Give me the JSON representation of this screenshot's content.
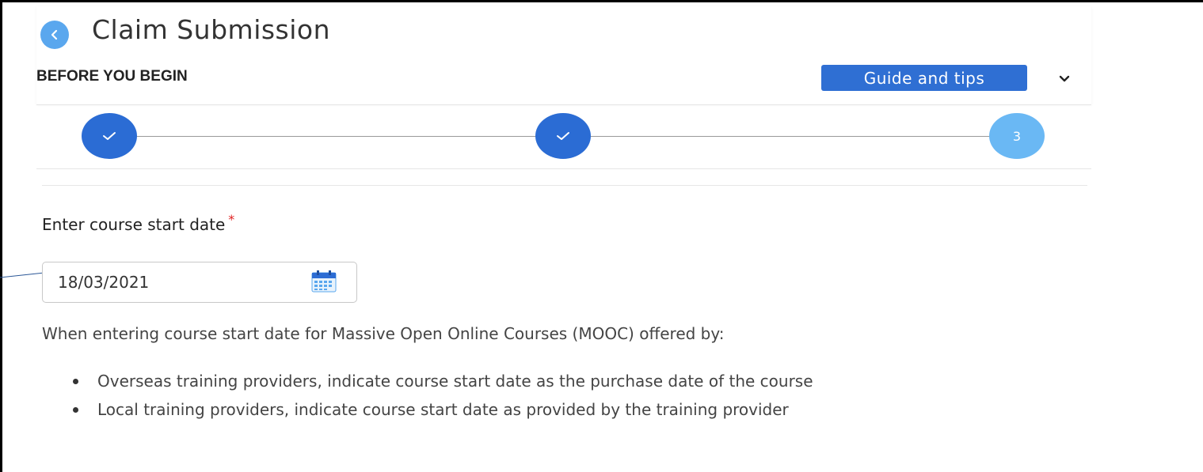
{
  "header": {
    "title": "Claim Submission",
    "section_title": "BEFORE YOU BEGIN",
    "guide_button_label": "Guide and tips"
  },
  "stepper": {
    "steps": [
      {
        "state": "completed",
        "label": ""
      },
      {
        "state": "completed",
        "label": ""
      },
      {
        "state": "current",
        "label": "3"
      }
    ],
    "colors": {
      "completed": "#2b6cd4",
      "current": "#6ab8f4"
    }
  },
  "form": {
    "start_date_label": "Enter course start date",
    "required_marker": "*",
    "start_date_value": "18/03/2021"
  },
  "info": {
    "intro": "When entering course start date for Massive Open Online Courses (MOOC) offered by:",
    "bullets": [
      "Overseas training providers, indicate course start date as the purchase date of the course",
      "Local training providers, indicate course start date as provided by the training provider"
    ]
  },
  "icons": {
    "back": "chevron-left-icon",
    "expand": "chevron-down-icon",
    "step_done": "check-icon",
    "calendar": "calendar-icon"
  },
  "colors": {
    "accent": "#2f6fd3",
    "back_button": "#5aa7ee",
    "required": "#e02020"
  }
}
